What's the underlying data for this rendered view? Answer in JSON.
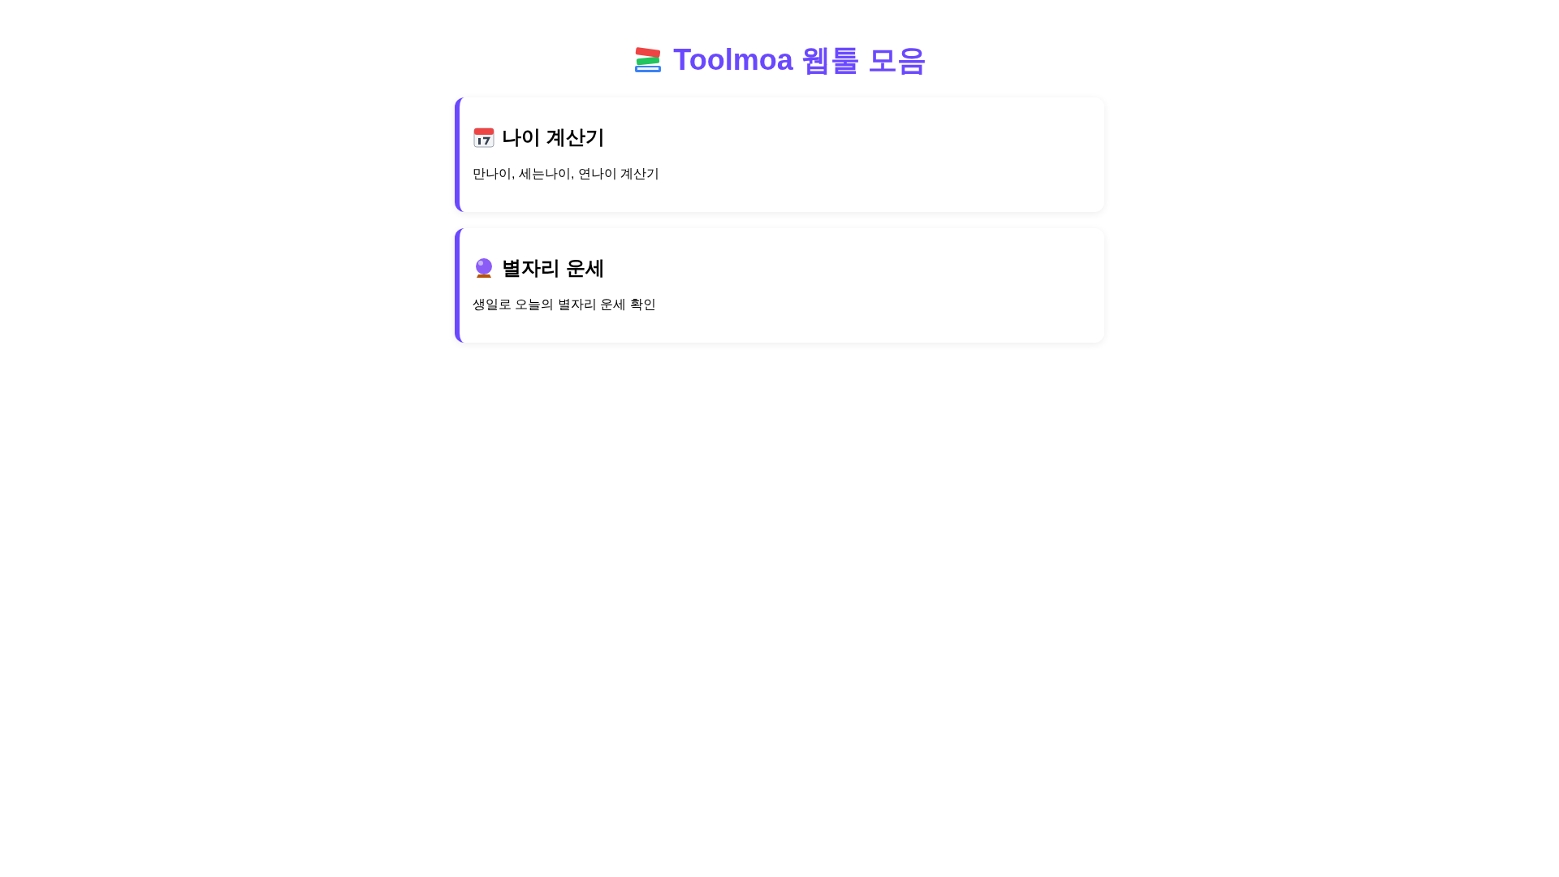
{
  "title": "Toolmoa 웹툴 모음",
  "cards": [
    {
      "kind": "calendar",
      "title": "나이 계산기",
      "description": "만나이, 세는나이, 연나이 계산기"
    },
    {
      "kind": "crystal-ball",
      "title": "별자리 운세",
      "description": "생일로 오늘의 별자리 운세 확인"
    }
  ]
}
